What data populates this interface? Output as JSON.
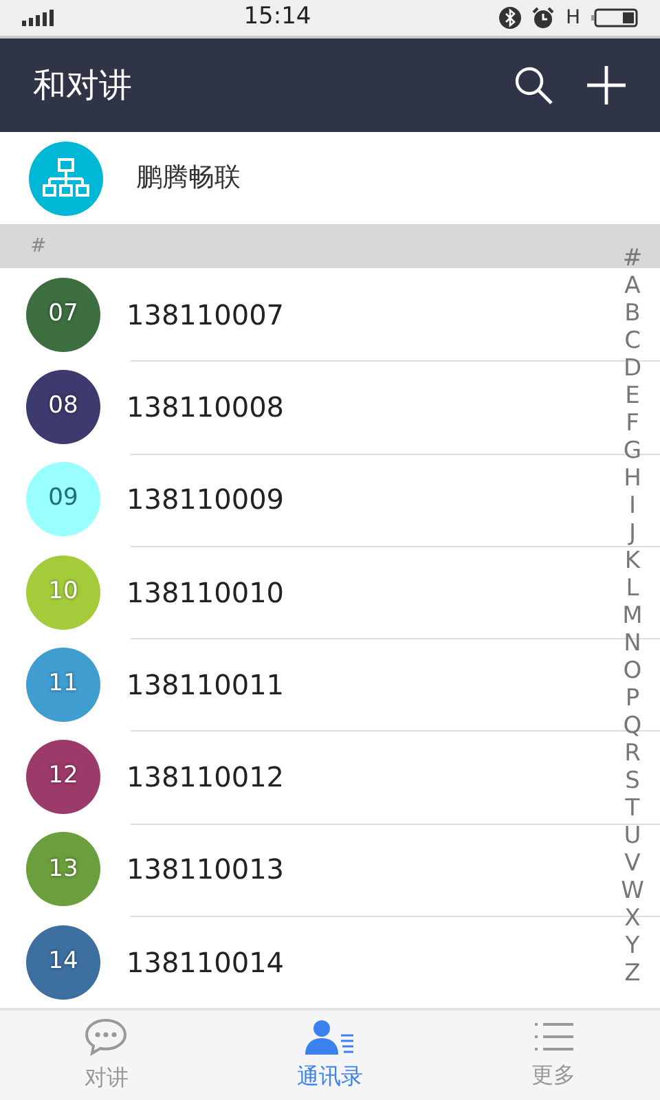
{
  "status_bar": {
    "time": "15:14",
    "network": "H"
  },
  "header": {
    "title": "和对讲"
  },
  "org": {
    "name": "鹏腾畅联"
  },
  "section": {
    "label": "#"
  },
  "contacts": [
    {
      "initials": "07",
      "number": "138110007",
      "color": "#3d6e3f"
    },
    {
      "initials": "08",
      "number": "138110008",
      "color": "#3c3a6e"
    },
    {
      "initials": "09",
      "number": "138110009",
      "color": "#99ffff"
    },
    {
      "initials": "10",
      "number": "138110010",
      "color": "#a4cc3a"
    },
    {
      "initials": "11",
      "number": "138110011",
      "color": "#3f9dd0"
    },
    {
      "initials": "12",
      "number": "138110012",
      "color": "#9c3a6a"
    },
    {
      "initials": "13",
      "number": "138110013",
      "color": "#6b9e3c"
    },
    {
      "initials": "14",
      "number": "138110014",
      "color": "#3d6fa0"
    }
  ],
  "index_bar": [
    "#",
    "A",
    "B",
    "C",
    "D",
    "E",
    "F",
    "G",
    "H",
    "I",
    "J",
    "K",
    "L",
    "M",
    "N",
    "O",
    "P",
    "Q",
    "R",
    "S",
    "T",
    "U",
    "V",
    "W",
    "X",
    "Y",
    "Z"
  ],
  "tabs": [
    {
      "label": "对讲",
      "kind": "chat",
      "selected": false
    },
    {
      "label": "通讯录",
      "kind": "contacts",
      "selected": true
    },
    {
      "label": "更多",
      "kind": "more",
      "selected": false
    }
  ]
}
